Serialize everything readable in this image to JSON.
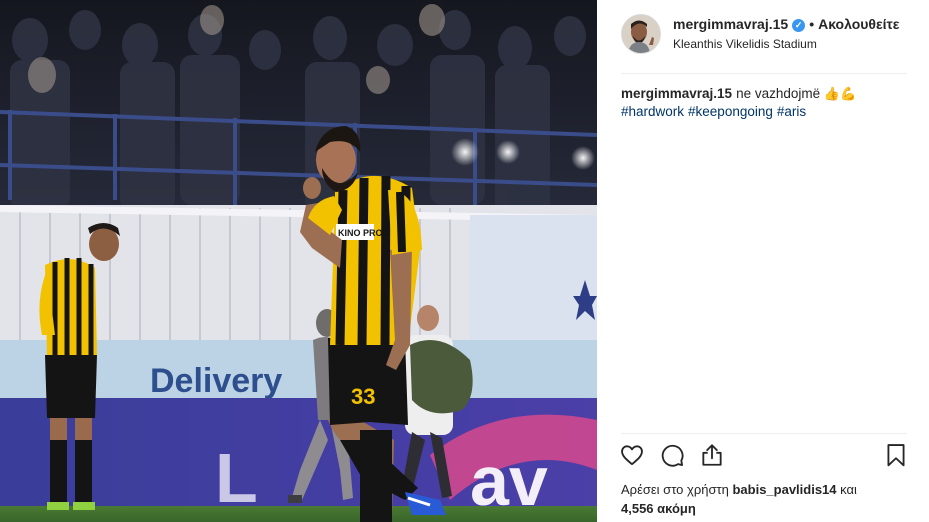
{
  "post": {
    "username": "mergimmavraj.15",
    "verified_badge": "✓",
    "separator": "•",
    "follow_label": "Ακολουθείτε",
    "location": "Kleanthis Vikelidis Stadium"
  },
  "caption": {
    "username": "mergimmavraj.15",
    "text": "ne vazhdojmë",
    "emojis": "👍💪",
    "hashtags": [
      "#hardwork",
      "#keepongoing",
      "#aris"
    ]
  },
  "actions": {
    "like_icon": "heart-icon",
    "comment_icon": "comment-icon",
    "share_icon": "share-icon",
    "save_icon": "bookmark-icon"
  },
  "likes": {
    "prefix": "Αρέσει στο χρήστη",
    "liker": "babis_pavlidis14",
    "conjunction": "και",
    "count": "4,556",
    "suffix": "ακόμη"
  },
  "photo": {
    "jersey_number": "33",
    "sponsor_text": "KINO PROFIS",
    "board_text_left": "Delivery",
    "board_text_right": "av"
  },
  "colors": {
    "link": "#003569",
    "verified": "#3897f0",
    "kit_yellow": "#f2c200",
    "kit_black": "#141414"
  }
}
